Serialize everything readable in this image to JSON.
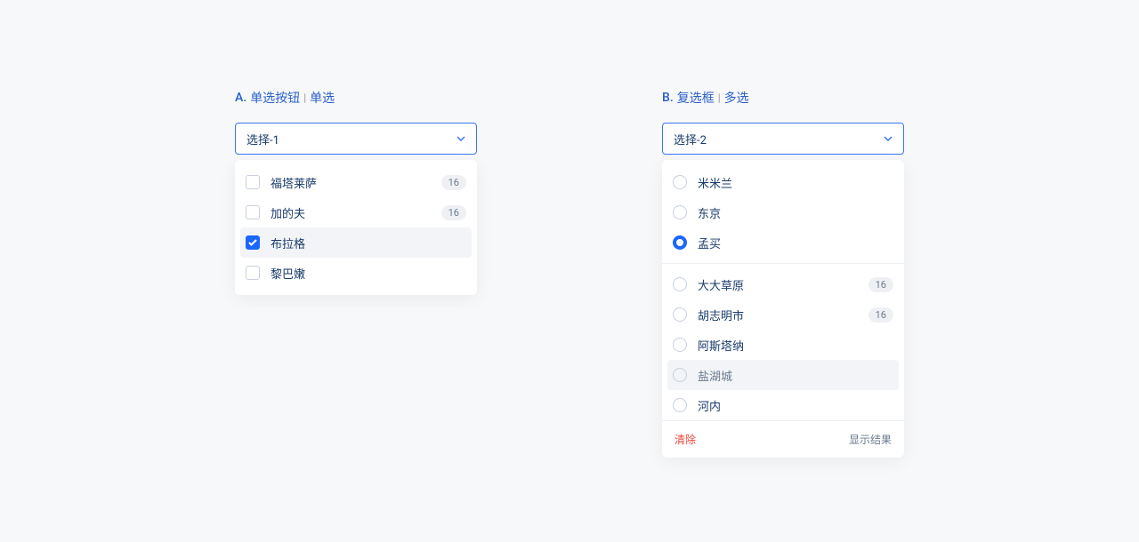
{
  "leftSection": {
    "prefix": "A.",
    "title1": "单选按钮",
    "divider": "|",
    "title2": "单选",
    "selectLabel": "选择-1",
    "options": [
      {
        "label": "福塔莱萨",
        "badge": "16",
        "checked": false,
        "highlight": false
      },
      {
        "label": "加的夫",
        "badge": "16",
        "checked": false,
        "highlight": false
      },
      {
        "label": "布拉格",
        "badge": null,
        "checked": true,
        "highlight": true
      },
      {
        "label": "黎巴嫩",
        "badge": null,
        "checked": false,
        "highlight": false
      }
    ]
  },
  "rightSection": {
    "prefix": "B.",
    "title1": "复选框",
    "divider": "|",
    "title2": "多选",
    "selectLabel": "选择-2",
    "group1": [
      {
        "label": "米米兰",
        "selected": false
      },
      {
        "label": "东京",
        "selected": false
      },
      {
        "label": "孟买",
        "selected": true
      }
    ],
    "group2": [
      {
        "label": "大大草原",
        "badge": "16",
        "selected": false,
        "highlight": false
      },
      {
        "label": "胡志明市",
        "badge": "16",
        "selected": false,
        "highlight": false
      },
      {
        "label": "阿斯塔纳",
        "badge": null,
        "selected": false,
        "highlight": false
      },
      {
        "label": "盐湖城",
        "badge": null,
        "selected": false,
        "highlight": true
      },
      {
        "label": "河内",
        "badge": null,
        "selected": false,
        "highlight": false
      }
    ],
    "clearLabel": "清除",
    "showLabel": "显示结果"
  }
}
